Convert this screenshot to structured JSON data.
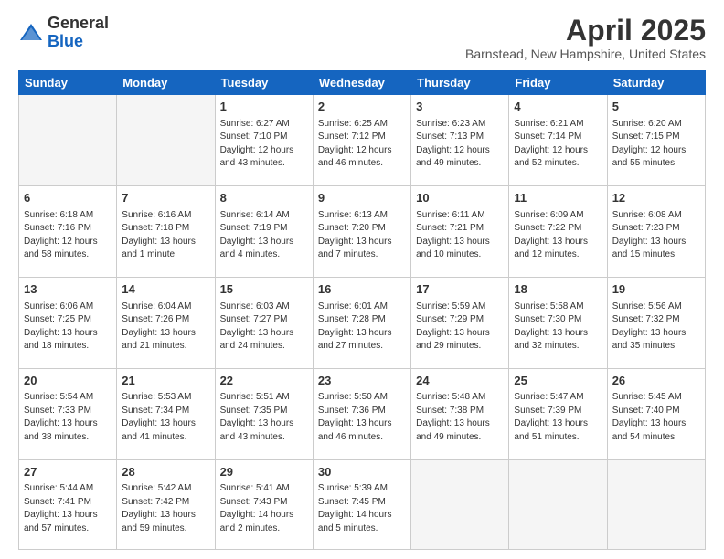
{
  "header": {
    "logo_general": "General",
    "logo_blue": "Blue",
    "month_title": "April 2025",
    "location": "Barnstead, New Hampshire, United States"
  },
  "days_of_week": [
    "Sunday",
    "Monday",
    "Tuesday",
    "Wednesday",
    "Thursday",
    "Friday",
    "Saturday"
  ],
  "weeks": [
    [
      {
        "day": "",
        "info": ""
      },
      {
        "day": "",
        "info": ""
      },
      {
        "day": "1",
        "info": "Sunrise: 6:27 AM\nSunset: 7:10 PM\nDaylight: 12 hours and 43 minutes."
      },
      {
        "day": "2",
        "info": "Sunrise: 6:25 AM\nSunset: 7:12 PM\nDaylight: 12 hours and 46 minutes."
      },
      {
        "day": "3",
        "info": "Sunrise: 6:23 AM\nSunset: 7:13 PM\nDaylight: 12 hours and 49 minutes."
      },
      {
        "day": "4",
        "info": "Sunrise: 6:21 AM\nSunset: 7:14 PM\nDaylight: 12 hours and 52 minutes."
      },
      {
        "day": "5",
        "info": "Sunrise: 6:20 AM\nSunset: 7:15 PM\nDaylight: 12 hours and 55 minutes."
      }
    ],
    [
      {
        "day": "6",
        "info": "Sunrise: 6:18 AM\nSunset: 7:16 PM\nDaylight: 12 hours and 58 minutes."
      },
      {
        "day": "7",
        "info": "Sunrise: 6:16 AM\nSunset: 7:18 PM\nDaylight: 13 hours and 1 minute."
      },
      {
        "day": "8",
        "info": "Sunrise: 6:14 AM\nSunset: 7:19 PM\nDaylight: 13 hours and 4 minutes."
      },
      {
        "day": "9",
        "info": "Sunrise: 6:13 AM\nSunset: 7:20 PM\nDaylight: 13 hours and 7 minutes."
      },
      {
        "day": "10",
        "info": "Sunrise: 6:11 AM\nSunset: 7:21 PM\nDaylight: 13 hours and 10 minutes."
      },
      {
        "day": "11",
        "info": "Sunrise: 6:09 AM\nSunset: 7:22 PM\nDaylight: 13 hours and 12 minutes."
      },
      {
        "day": "12",
        "info": "Sunrise: 6:08 AM\nSunset: 7:23 PM\nDaylight: 13 hours and 15 minutes."
      }
    ],
    [
      {
        "day": "13",
        "info": "Sunrise: 6:06 AM\nSunset: 7:25 PM\nDaylight: 13 hours and 18 minutes."
      },
      {
        "day": "14",
        "info": "Sunrise: 6:04 AM\nSunset: 7:26 PM\nDaylight: 13 hours and 21 minutes."
      },
      {
        "day": "15",
        "info": "Sunrise: 6:03 AM\nSunset: 7:27 PM\nDaylight: 13 hours and 24 minutes."
      },
      {
        "day": "16",
        "info": "Sunrise: 6:01 AM\nSunset: 7:28 PM\nDaylight: 13 hours and 27 minutes."
      },
      {
        "day": "17",
        "info": "Sunrise: 5:59 AM\nSunset: 7:29 PM\nDaylight: 13 hours and 29 minutes."
      },
      {
        "day": "18",
        "info": "Sunrise: 5:58 AM\nSunset: 7:30 PM\nDaylight: 13 hours and 32 minutes."
      },
      {
        "day": "19",
        "info": "Sunrise: 5:56 AM\nSunset: 7:32 PM\nDaylight: 13 hours and 35 minutes."
      }
    ],
    [
      {
        "day": "20",
        "info": "Sunrise: 5:54 AM\nSunset: 7:33 PM\nDaylight: 13 hours and 38 minutes."
      },
      {
        "day": "21",
        "info": "Sunrise: 5:53 AM\nSunset: 7:34 PM\nDaylight: 13 hours and 41 minutes."
      },
      {
        "day": "22",
        "info": "Sunrise: 5:51 AM\nSunset: 7:35 PM\nDaylight: 13 hours and 43 minutes."
      },
      {
        "day": "23",
        "info": "Sunrise: 5:50 AM\nSunset: 7:36 PM\nDaylight: 13 hours and 46 minutes."
      },
      {
        "day": "24",
        "info": "Sunrise: 5:48 AM\nSunset: 7:38 PM\nDaylight: 13 hours and 49 minutes."
      },
      {
        "day": "25",
        "info": "Sunrise: 5:47 AM\nSunset: 7:39 PM\nDaylight: 13 hours and 51 minutes."
      },
      {
        "day": "26",
        "info": "Sunrise: 5:45 AM\nSunset: 7:40 PM\nDaylight: 13 hours and 54 minutes."
      }
    ],
    [
      {
        "day": "27",
        "info": "Sunrise: 5:44 AM\nSunset: 7:41 PM\nDaylight: 13 hours and 57 minutes."
      },
      {
        "day": "28",
        "info": "Sunrise: 5:42 AM\nSunset: 7:42 PM\nDaylight: 13 hours and 59 minutes."
      },
      {
        "day": "29",
        "info": "Sunrise: 5:41 AM\nSunset: 7:43 PM\nDaylight: 14 hours and 2 minutes."
      },
      {
        "day": "30",
        "info": "Sunrise: 5:39 AM\nSunset: 7:45 PM\nDaylight: 14 hours and 5 minutes."
      },
      {
        "day": "",
        "info": ""
      },
      {
        "day": "",
        "info": ""
      },
      {
        "day": "",
        "info": ""
      }
    ]
  ]
}
